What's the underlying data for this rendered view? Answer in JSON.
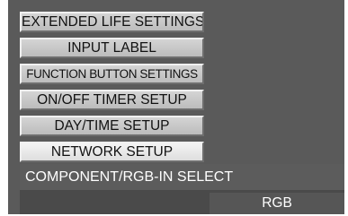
{
  "menu": {
    "items": [
      {
        "label": "EXTENDED LIFE SETTINGS"
      },
      {
        "label": "INPUT LABEL"
      },
      {
        "label": "FUNCTION BUTTON SETTINGS"
      },
      {
        "label": "ON/OFF TIMER SETUP"
      },
      {
        "label": "DAY/TIME SETUP"
      },
      {
        "label": "NETWORK SETUP"
      }
    ],
    "selected_item": "NETWORK SETUP"
  },
  "component_select": {
    "label": "COMPONENT/RGB-IN SELECT",
    "value": "RGB"
  },
  "colors": {
    "background": "#5a5a5a",
    "button_face": "#c8c8c8",
    "selected_button_face": "#ececec",
    "text_light": "#ffffff"
  }
}
